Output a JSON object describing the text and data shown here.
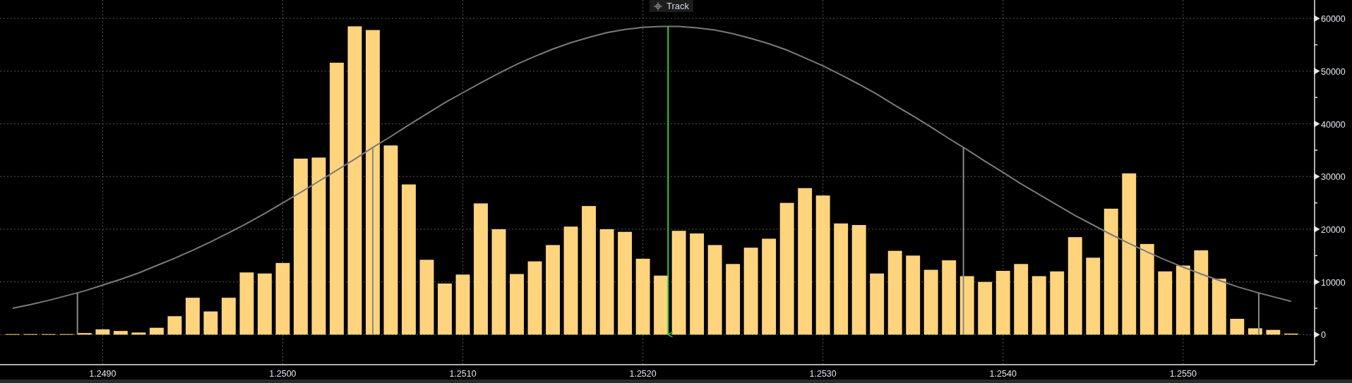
{
  "track_button": {
    "label": "Track"
  },
  "chart_data": {
    "type": "bar",
    "x": [
      1.2485,
      1.2486,
      1.2487,
      1.2488,
      1.2489,
      1.249,
      1.2491,
      1.2492,
      1.2493,
      1.2494,
      1.2495,
      1.2496,
      1.2497,
      1.2498,
      1.2499,
      1.25,
      1.2501,
      1.2502,
      1.2503,
      1.2504,
      1.2505,
      1.2506,
      1.2507,
      1.2508,
      1.2509,
      1.251,
      1.2511,
      1.2512,
      1.2513,
      1.2514,
      1.2515,
      1.2516,
      1.2517,
      1.2518,
      1.2519,
      1.252,
      1.2521,
      1.2522,
      1.2523,
      1.2524,
      1.2525,
      1.2526,
      1.2527,
      1.2528,
      1.2529,
      1.253,
      1.2531,
      1.2532,
      1.2533,
      1.2534,
      1.2535,
      1.2536,
      1.2537,
      1.2538,
      1.2539,
      1.254,
      1.2541,
      1.2542,
      1.2543,
      1.2544,
      1.2545,
      1.2546,
      1.2547,
      1.2548,
      1.2549,
      1.255,
      1.2551,
      1.2552,
      1.2553,
      1.2554,
      1.2555,
      1.2556
    ],
    "series": [
      {
        "type": "bar",
        "color": "#ffd47c",
        "values": [
          100,
          100,
          100,
          100,
          300,
          1000,
          700,
          400,
          1300,
          3500,
          7000,
          4400,
          7000,
          11800,
          11600,
          13600,
          33400,
          33600,
          51600,
          58500,
          57800,
          35900,
          28500,
          14200,
          9700,
          11400,
          24900,
          20000,
          11500,
          13900,
          17000,
          20500,
          24400,
          20000,
          19500,
          14400,
          11200,
          19700,
          19200,
          17000,
          13400,
          16500,
          18200,
          25000,
          27800,
          26400,
          21100,
          20800,
          11600,
          15900,
          15000,
          12300,
          14100,
          11100,
          10000,
          12100,
          13400,
          11100,
          12000,
          18500,
          14600,
          23900,
          30600,
          17200,
          12000,
          13100,
          16000,
          10600,
          3000,
          1200,
          900,
          200
        ]
      },
      {
        "type": "line",
        "color": "#7a7a7a",
        "values": [
          5000,
          5700,
          6500,
          7400,
          8300,
          9400,
          10500,
          11700,
          13100,
          14500,
          16000,
          17600,
          19300,
          21100,
          23000,
          25000,
          27000,
          29100,
          31200,
          33300,
          35500,
          37600,
          39800,
          41900,
          44000,
          45900,
          47800,
          49600,
          51300,
          52800,
          54200,
          55400,
          56400,
          57300,
          57900,
          58300,
          58500,
          58500,
          58200,
          57800,
          57100,
          56200,
          55200,
          54000,
          52500,
          51000,
          49300,
          47500,
          45600,
          43500,
          41500,
          39400,
          37200,
          35100,
          32900,
          30800,
          28600,
          26600,
          24600,
          22600,
          20800,
          19000,
          17300,
          15700,
          14200,
          12800,
          11500,
          10300,
          9100,
          8100,
          7200,
          6300
        ]
      }
    ],
    "xlim": [
      1.24843,
      1.25573
    ],
    "ylim": [
      -5700,
      63500
    ],
    "xticks": [
      {
        "value": 1.249,
        "label": "1.2490"
      },
      {
        "value": 1.25,
        "label": "1.2500"
      },
      {
        "value": 1.251,
        "label": "1.2510"
      },
      {
        "value": 1.252,
        "label": "1.2520"
      },
      {
        "value": 1.253,
        "label": "1.2530"
      },
      {
        "value": 1.254,
        "label": "1.2540"
      },
      {
        "value": 1.255,
        "label": "1.2550"
      }
    ],
    "yticks": [
      0,
      10000,
      20000,
      30000,
      40000,
      50000,
      60000
    ],
    "grid": true,
    "ref_lines": [
      {
        "axis": "x",
        "value": 1.24886,
        "color": "#8a8a8a"
      },
      {
        "axis": "x",
        "value": 1.2505,
        "color": "#8a8a8a"
      },
      {
        "axis": "x",
        "value": 1.25378,
        "color": "#8a8a8a"
      },
      {
        "axis": "x",
        "value": 1.25542,
        "color": "#8a8a8a"
      },
      {
        "axis": "x",
        "value": 1.25214,
        "color": "#33cc33"
      }
    ]
  }
}
